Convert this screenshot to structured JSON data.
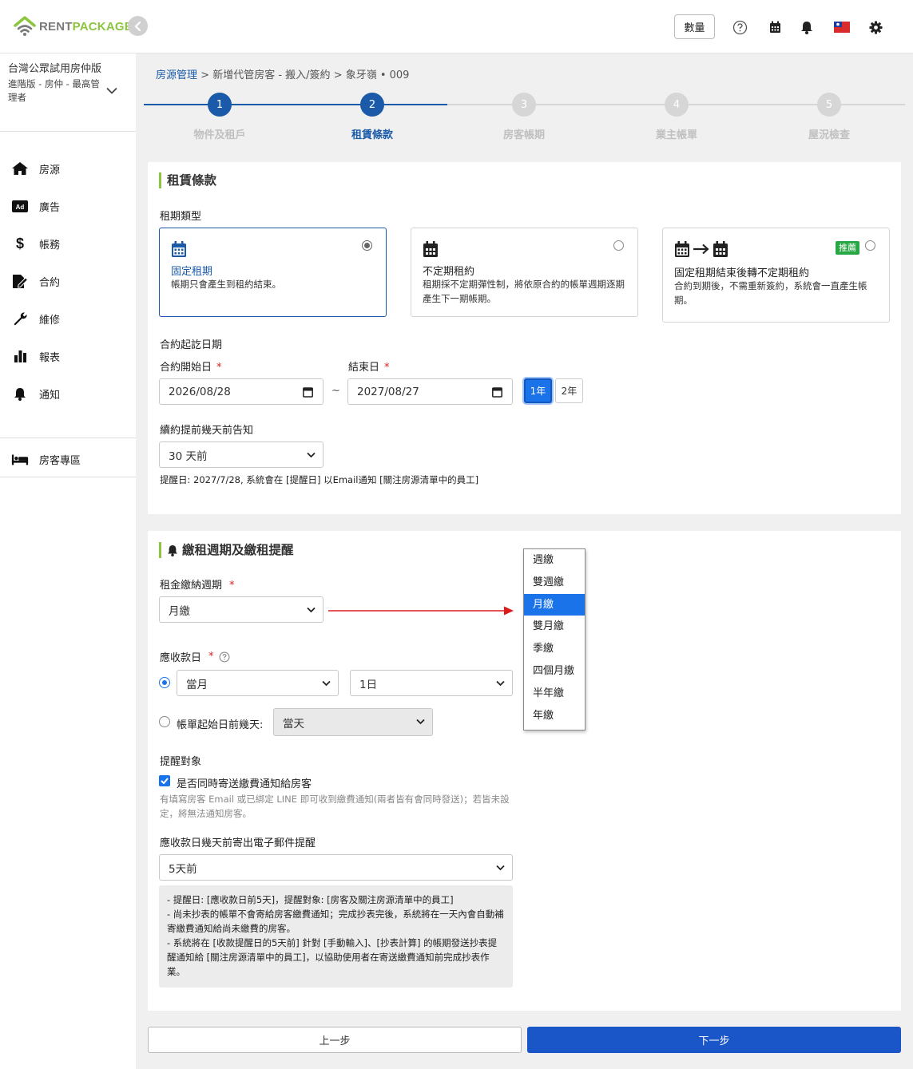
{
  "app": {
    "logo_a": "RENT",
    "logo_b": "PACKAGE",
    "qty_label": "數量"
  },
  "sidebar": {
    "org_name": "台灣公眾試用房仲版",
    "org_role": "進階版 - 房仲 - 最高管理者",
    "items": [
      {
        "label": "房源",
        "icon": "home-icon"
      },
      {
        "label": "廣告",
        "icon": "ad-icon"
      },
      {
        "label": "帳務",
        "icon": "dollar-icon"
      },
      {
        "label": "合約",
        "icon": "contract-icon"
      },
      {
        "label": "維修",
        "icon": "wrench-icon"
      },
      {
        "label": "報表",
        "icon": "bar-chart-icon"
      },
      {
        "label": "通知",
        "icon": "bell-icon"
      }
    ],
    "tenant_area": "房客專區"
  },
  "breadcrumb": {
    "root": "房源管理",
    "sep": ">",
    "path": "新增代管房客 - 搬入/簽約 > 象牙嶺 • 009"
  },
  "steps": [
    {
      "num": "1",
      "label": "物件及租戶",
      "state": "done"
    },
    {
      "num": "2",
      "label": "租賃條款",
      "state": "active"
    },
    {
      "num": "3",
      "label": "房客帳期",
      "state": "todo"
    },
    {
      "num": "4",
      "label": "業主帳單",
      "state": "todo"
    },
    {
      "num": "5",
      "label": "屋況檢查",
      "state": "todo"
    }
  ],
  "lease": {
    "title": "租賃條款",
    "type_label": "租期類型",
    "options": [
      {
        "title": "固定租期",
        "desc": "帳期只會產生到租約結束。",
        "selected": true
      },
      {
        "title": "不定期租約",
        "desc": "租期採不定期彈性制，將依原合約的帳單週期逐期產生下一期帳期。",
        "selected": false
      },
      {
        "title": "固定租期結束後轉不定期租約",
        "desc": "合約到期後，不需重新簽約，系統會一直產生帳期。",
        "badge": "推薦",
        "selected": false
      }
    ],
    "period_label": "合約起訖日期",
    "start_label": "合約開始日",
    "end_label": "結束日",
    "start_value": "2026/08/28",
    "end_value": "2027/08/27",
    "tilde": "~",
    "year1": "1年",
    "year2": "2年",
    "renew_label": "續約提前幾天前告知",
    "renew_value": "30 天前",
    "renew_hint": "提醒日: 2027/7/28, 系統會在 [提醒日] 以Email通知 [關注房源清單中的員工]"
  },
  "payment": {
    "title": "繳租週期及繳租提醒",
    "cycle_label": "租金繳納週期",
    "cycle_value": "月繳",
    "cycle_options": [
      "週繳",
      "雙週繳",
      "月繳",
      "雙月繳",
      "季繳",
      "四個月繳",
      "半年繳",
      "年繳"
    ],
    "due_label": "應收款日",
    "due_month": "當月",
    "due_day": "1日",
    "before_label": "帳單起始日前幾天:",
    "before_value": "當天",
    "notify_label": "提醒對象",
    "notify_check": "是否同時寄送繳費通知給房客",
    "notify_hint": "有填寫房客 Email 或已綁定 LINE 即可收到繳費通知(兩者皆有會同時發送)；若皆未設定，將無法通知房客。",
    "email_label": "應收款日幾天前寄出電子郵件提醒",
    "email_value": "5天前",
    "notes": [
      "- 提醒日: [應收款日前5天]，提醒對象: [房客及關注房源清單中的員工]",
      "- 尚未抄表的帳單不會寄給房客繳費通知；完成抄表完後，系統將在一天內會自動補寄繳費通知給尚未繳費的房客。",
      "- 系統將在 [收款提醒日的5天前] 針對 [手動輸入]、[抄表計算] 的帳期發送抄表提醒通知給 [關注房源清單中的員工]，以協助使用者在寄送繳費通知前完成抄表作業。"
    ]
  },
  "buttons": {
    "prev": "上一步",
    "next": "下一步"
  },
  "colors": {
    "brand_blue": "#1a5aa8",
    "accent_green": "#8cc63f",
    "primary": "#1a73e8"
  }
}
